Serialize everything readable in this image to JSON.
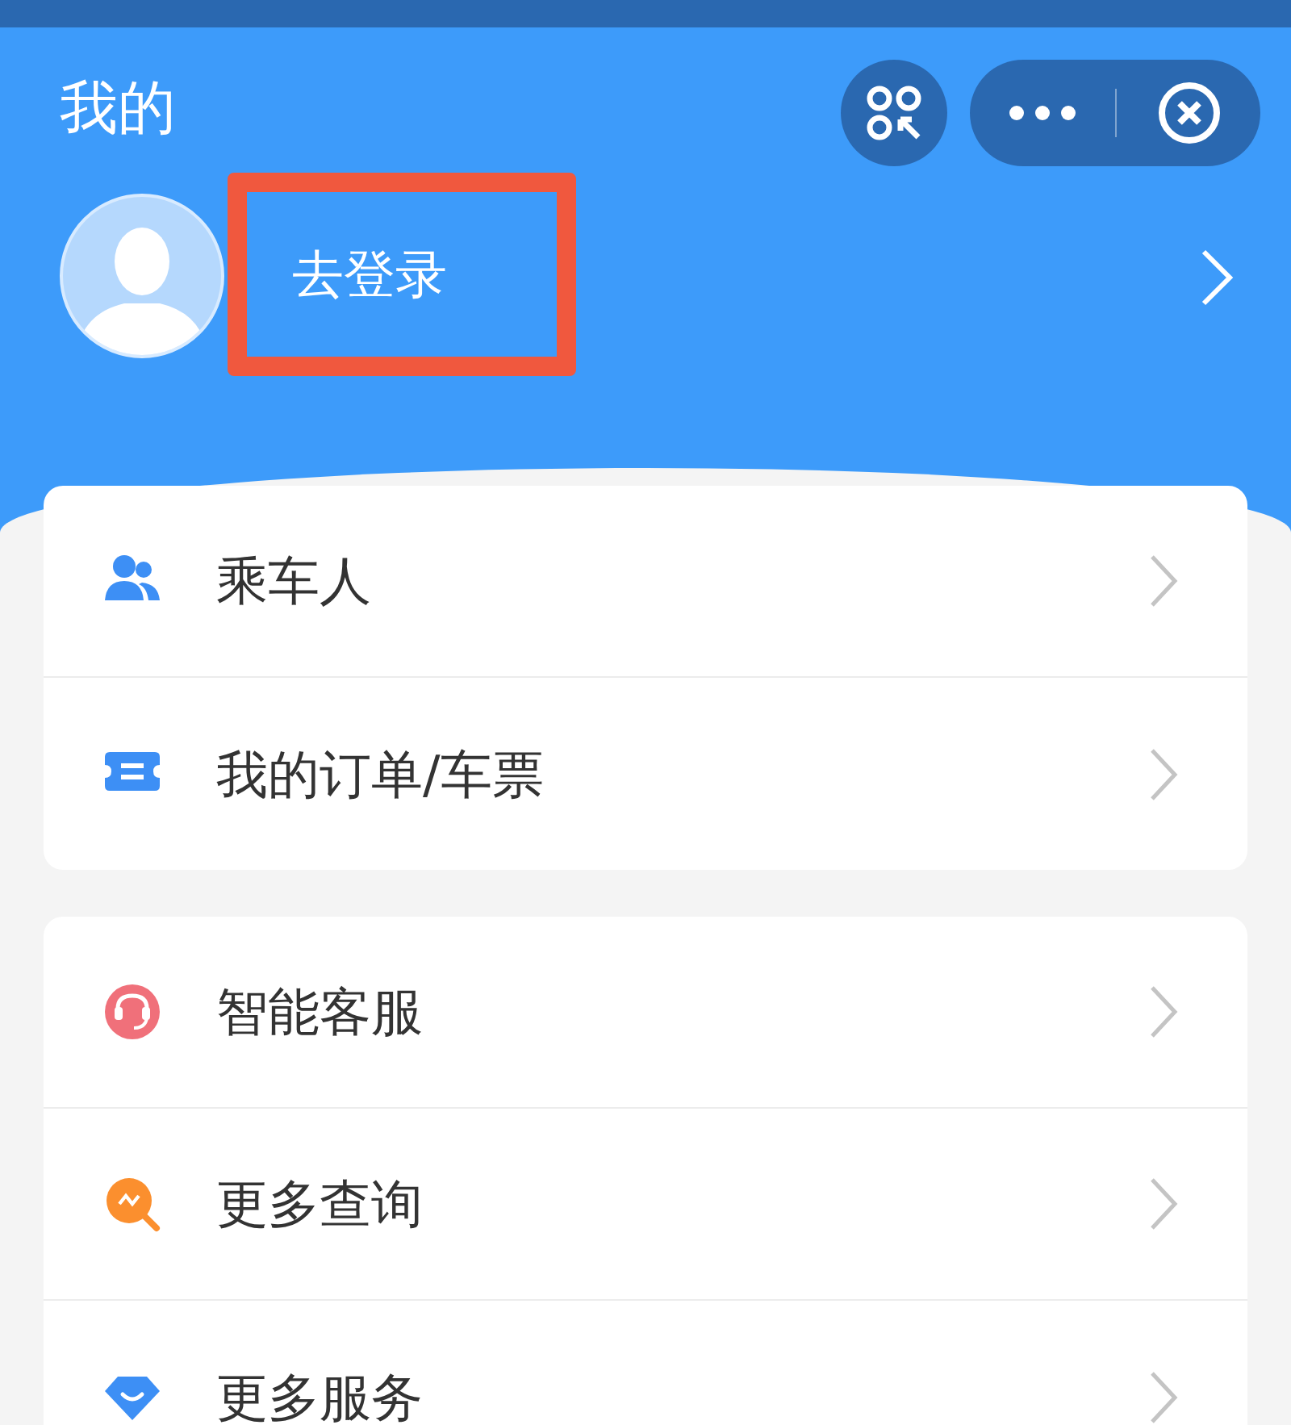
{
  "header": {
    "title": "我的",
    "login": {
      "label": "去登录",
      "highlighted": true
    }
  },
  "menu_groups": [
    {
      "items": [
        {
          "label": "乘车人",
          "kind": "people",
          "color": "#3d8ff5"
        },
        {
          "label": "我的订单/车票",
          "kind": "ticket",
          "color": "#3d8ff5"
        }
      ]
    },
    {
      "items": [
        {
          "label": "智能客服",
          "kind": "headset",
          "color": "#f0707a"
        },
        {
          "label": "更多查询",
          "kind": "search",
          "color": "#fb8f2e"
        },
        {
          "label": "更多服务",
          "kind": "diamond",
          "color": "#3d8ff5"
        }
      ]
    }
  ]
}
